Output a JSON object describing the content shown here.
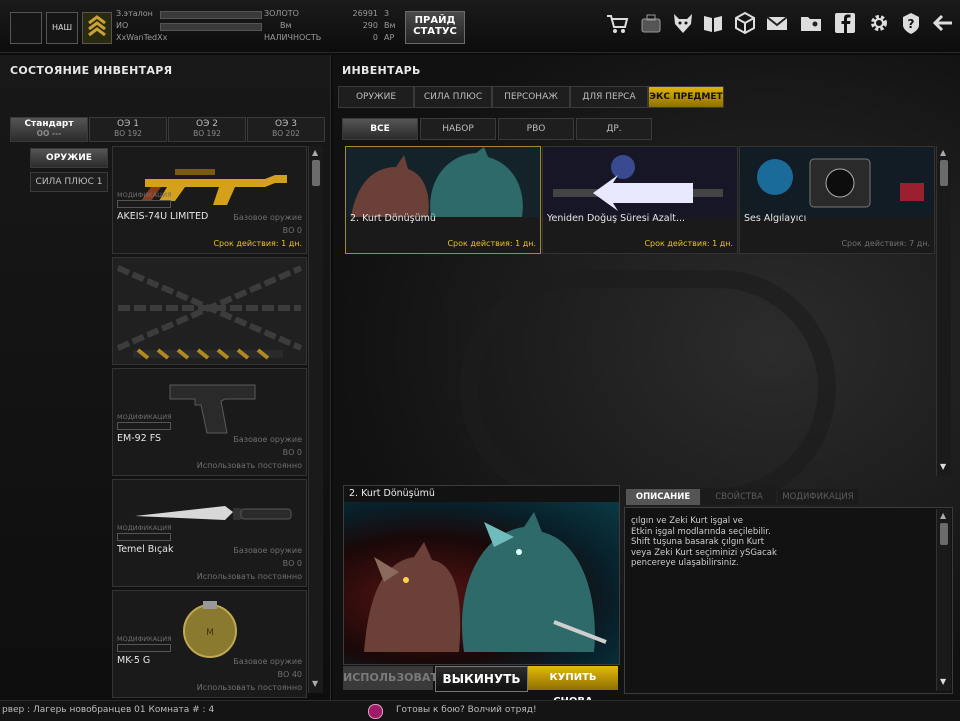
{
  "player": {
    "rank_label": "З.эталон",
    "clan_tag": "НАШ",
    "line2": "ИО",
    "nickname": "XxWanTedXx",
    "gold_label": "ЗОЛОТО",
    "gold_value": "26991",
    "gold_count": "3",
    "vm_label": "Вм",
    "vm_value": "290",
    "vm_suffix": "Вм",
    "nal_label": "НАЛИЧНОСТЬ",
    "nal_value": "0",
    "ap_label": "AP"
  },
  "topbar": {
    "status_button": "ПРАЙД\nСТАТУС",
    "icons": [
      "cart-icon",
      "bag-icon",
      "wolf-icon",
      "book-icon",
      "cube-icon",
      "mail-icon",
      "folder-user-icon",
      "facebook-icon",
      "gear-icon",
      "help-icon",
      "back-arrow-icon"
    ]
  },
  "left_panel": {
    "title": "СОСТОЯНИЕ ИНВЕНТАРЯ",
    "preset_tabs": [
      {
        "label": "Стандарт",
        "sub": "OO ---",
        "active": true
      },
      {
        "label": "ОЭ 1",
        "sub": "ВО 192",
        "active": false
      },
      {
        "label": "ОЭ 2",
        "sub": "ВО 192",
        "active": false
      },
      {
        "label": "ОЭ 3",
        "sub": "ВО 202",
        "active": false
      }
    ],
    "category_buttons": [
      "ОРУЖИЕ",
      "СИЛА ПЛЮС 1"
    ],
    "items": [
      {
        "name": "AKEIS-74U LIMITED",
        "type": "Базовое оружие",
        "bo": "ВО 0",
        "duration": "Срок действия: 1 дн.",
        "mod": "МОДИФИКАЦИЯ",
        "kind": "rifle"
      },
      {
        "name": "",
        "type": "",
        "bo": "",
        "duration": "",
        "mod": "",
        "kind": "locked"
      },
      {
        "name": "EM-92 FS",
        "type": "Базовое оружие",
        "bo": "ВО 0",
        "duration": "Использовать постоянно",
        "mod": "МОДИФИКАЦИЯ",
        "kind": "pistol"
      },
      {
        "name": "Temel Bıçak",
        "type": "Базовое оружие",
        "bo": "ВО 0",
        "duration": "Использовать постоянно",
        "mod": "МОДИФИКАЦИЯ",
        "kind": "knife"
      },
      {
        "name": "MK-5 G",
        "type": "Базовое оружие",
        "bo": "ВО 40",
        "duration": "Использовать постоянно",
        "mod": "МОДИФИКАЦИЯ",
        "kind": "grenade"
      }
    ]
  },
  "right_panel": {
    "title": "ИНВЕНТАРЬ",
    "main_tabs": [
      {
        "label": "ОРУЖИЕ",
        "style": "normal"
      },
      {
        "label": "СИЛА ПЛЮС",
        "style": "normal"
      },
      {
        "label": "ПЕРСОНАЖ",
        "style": "normal"
      },
      {
        "label": "ДЛЯ ПЕРСА",
        "style": "normal"
      },
      {
        "label": "ЭКС ПРЕДМЕТ",
        "style": "gold"
      }
    ],
    "sub_tabs": [
      {
        "label": "ВСЕ",
        "active": true
      },
      {
        "label": "НАБОР",
        "active": false
      },
      {
        "label": "РВО",
        "active": false
      },
      {
        "label": "ДР.",
        "active": false
      }
    ],
    "items": [
      {
        "name": "2. Kurt Dönüşümü",
        "duration": "Срок действия: 1 дн.",
        "kind": "werewolf",
        "selected": true
      },
      {
        "name": "Yeniden Doğuş Süresi Azalt...",
        "duration": "Срок действия: 1 дн.",
        "kind": "arrow",
        "selected": false
      },
      {
        "name": "Ses Algılayıcı",
        "duration": "Срок действия: 7 дн.",
        "kind": "sensor",
        "selected": false
      }
    ],
    "detail": {
      "title": "2. Kurt Dönüşümü",
      "tabs": [
        {
          "label": "ОПИСАНИЕ",
          "active": true
        },
        {
          "label": "СВОЙСТВА",
          "active": false
        },
        {
          "label": "МОДИФИКАЦИЯ",
          "active": false
        }
      ],
      "description": "çılgın ve Zeki Kurt işgal ve\nEtkin işgal modlarında seçilebilir.\nShift tuşuna basarak çılgın Kurt\nveya Zeki Kurt seçiminizi ySGacak\npencereye ulaşabilirsiniz.",
      "buttons": [
        {
          "label": "ИСПОЛЬЗОВАТЬ",
          "style": "disabled"
        },
        {
          "label": "ВЫКИНУТЬ",
          "style": "dark"
        },
        {
          "label": "КУПИТЬ СНОВА",
          "style": "gold"
        }
      ]
    }
  },
  "chat": {
    "left": "рвер : Лагерь новобранцев 01 Комната # : 4",
    "right": "Готовы к бою? Волчий отряд!"
  },
  "colors": {
    "accent": "#e1b400",
    "duration": "#e9c12b",
    "panel": "#1a1a1a"
  }
}
